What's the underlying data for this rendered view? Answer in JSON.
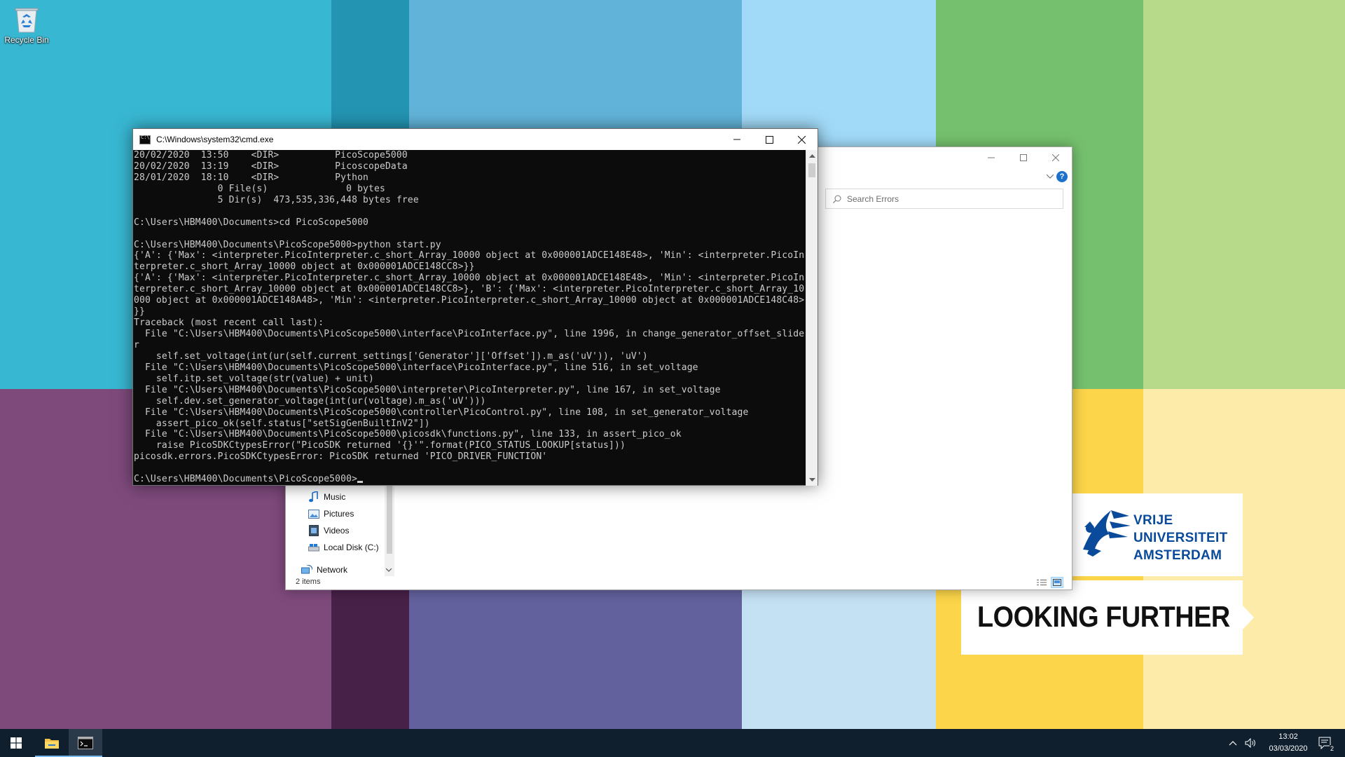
{
  "desktop": {
    "recycle_bin_label": "Recycle Bin",
    "logo": {
      "lines": [
        "VRIJE",
        "UNIVERSITEIT",
        "AMSTERDAM"
      ],
      "slogan": "LOOKING FURTHER"
    }
  },
  "colors": {
    "wallpaper": [
      "#38b7d2",
      "#2394b2",
      "#62b3d9",
      "#a1daf8",
      "#75c06e",
      "#b6d98a",
      "#7e4a7c",
      "#482148",
      "#63619d",
      "#c4e1f4",
      "#fcd54a",
      "#fdebaa"
    ],
    "vu_blue": "#0a4a9a",
    "taskbar": "#0f1f2e",
    "console_text": "#cccccc"
  },
  "explorer": {
    "search_placeholder": "Search Errors",
    "nav_items": [
      {
        "label": "Music",
        "icon": "music-icon"
      },
      {
        "label": "Pictures",
        "icon": "pictures-icon"
      },
      {
        "label": "Videos",
        "icon": "videos-icon"
      },
      {
        "label": "Local Disk (C:)",
        "icon": "local-disk-icon"
      },
      {
        "label": "Network",
        "icon": "network-icon"
      }
    ],
    "status_text": "2 items"
  },
  "cmd": {
    "title": "C:\\Windows\\system32\\cmd.exe",
    "output": "20/02/2020  13:50    <DIR>          PicoScope5000\n20/02/2020  13:19    <DIR>          PicoscopeData\n28/01/2020  18:10    <DIR>          Python\n               0 File(s)              0 bytes\n               5 Dir(s)  473,535,336,448 bytes free\n\nC:\\Users\\HBM400\\Documents>cd PicoScope5000\n\nC:\\Users\\HBM400\\Documents\\PicoScope5000>python start.py\n{'A': {'Max': <interpreter.PicoInterpreter.c_short_Array_10000 object at 0x000001ADCE148E48>, 'Min': <interpreter.PicoIn\nterpreter.c_short_Array_10000 object at 0x000001ADCE148CC8>}}\n{'A': {'Max': <interpreter.PicoInterpreter.c_short_Array_10000 object at 0x000001ADCE148E48>, 'Min': <interpreter.PicoIn\nterpreter.c_short_Array_10000 object at 0x000001ADCE148CC8>}, 'B': {'Max': <interpreter.PicoInterpreter.c_short_Array_10\n000 object at 0x000001ADCE148A48>, 'Min': <interpreter.PicoInterpreter.c_short_Array_10000 object at 0x000001ADCE148C48>\n}}\nTraceback (most recent call last):\n  File \"C:\\Users\\HBM400\\Documents\\PicoScope5000\\interface\\PicoInterface.py\", line 1996, in change_generator_offset_slide\nr\n    self.set_voltage(int(ur(self.current_settings['Generator']['Offset']).m_as('uV')), 'uV')\n  File \"C:\\Users\\HBM400\\Documents\\PicoScope5000\\interface\\PicoInterface.py\", line 516, in set_voltage\n    self.itp.set_voltage(str(value) + unit)\n  File \"C:\\Users\\HBM400\\Documents\\PicoScope5000\\interpreter\\PicoInterpreter.py\", line 167, in set_voltage\n    self.dev.set_generator_voltage(int(ur(voltage).m_as('uV')))\n  File \"C:\\Users\\HBM400\\Documents\\PicoScope5000\\controller\\PicoControl.py\", line 108, in set_generator_voltage\n    assert_pico_ok(self.status[\"setSigGenBuiltInV2\"])\n  File \"C:\\Users\\HBM400\\Documents\\PicoScope5000\\picosdk\\functions.py\", line 133, in assert_pico_ok\n    raise PicoSDKCtypesError(\"PicoSDK returned '{}'\".format(PICO_STATUS_LOOKUP[status]))\npicosdk.errors.PicoSDKCtypesError: PicoSDK returned 'PICO_DRIVER_FUNCTION'\n\nC:\\Users\\HBM400\\Documents\\PicoScope5000>"
  },
  "taskbar": {
    "time": "13:02",
    "date": "03/03/2020",
    "notification_count": "2"
  }
}
